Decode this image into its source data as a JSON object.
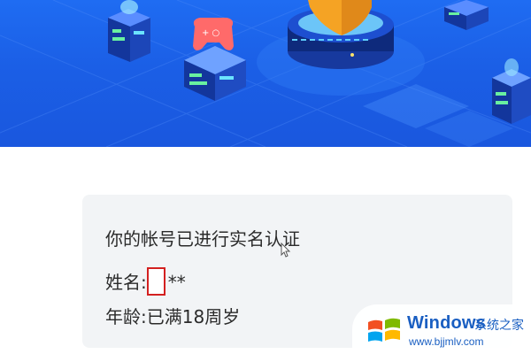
{
  "banner": {
    "gamepad_icon_glyph": "+ ○"
  },
  "verification": {
    "status_text": "你的帐号已进行实名认证",
    "name_label": "姓名:",
    "name_masked_suffix": "**",
    "age_label": "年龄:",
    "age_value": "已满18周岁"
  },
  "watermark": {
    "title": "Windows",
    "subtitle": "系统之家",
    "url": "www.bjjmlv.com"
  },
  "colors": {
    "banner_blue": "#1b5fe6",
    "card_background": "#f2f4f6",
    "redaction_red": "#d32020",
    "watermark_blue": "#1a5fc2"
  }
}
